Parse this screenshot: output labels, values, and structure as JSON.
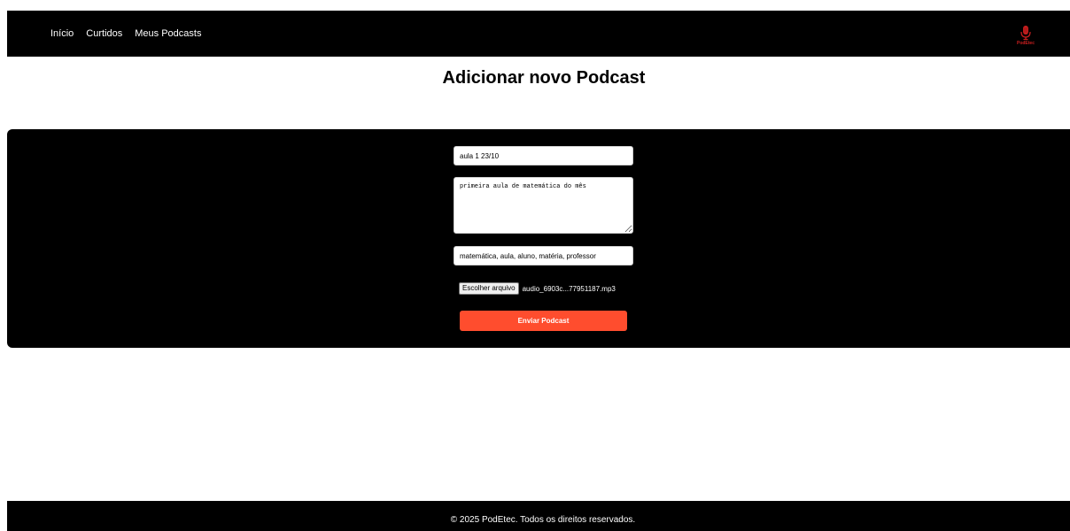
{
  "navbar": {
    "links": [
      {
        "label": "Início"
      },
      {
        "label": "Curtidos"
      },
      {
        "label": "Meus Podcasts"
      }
    ],
    "logo": {
      "text": "PodEtec",
      "icon": "microphone-icon",
      "color": "#cc1f1f"
    }
  },
  "page": {
    "title": "Adicionar novo Podcast"
  },
  "form": {
    "title_value": "aula 1 23/10",
    "description_value": "primeira aula de matemática do mês",
    "tags_value": "matemática, aula, aluno, matéria, professor",
    "file_button_label": "Escolher arquivo",
    "file_name": "audio_6903c...77951187.mp3",
    "submit_label": "Enviar Podcast"
  },
  "footer": {
    "text": "© 2025 PodEtec. Todos os direitos reservados."
  },
  "colors": {
    "background": "#ffffff",
    "bars": "#000000",
    "accent": "#ff4d2e",
    "logo": "#cc1f1f"
  }
}
